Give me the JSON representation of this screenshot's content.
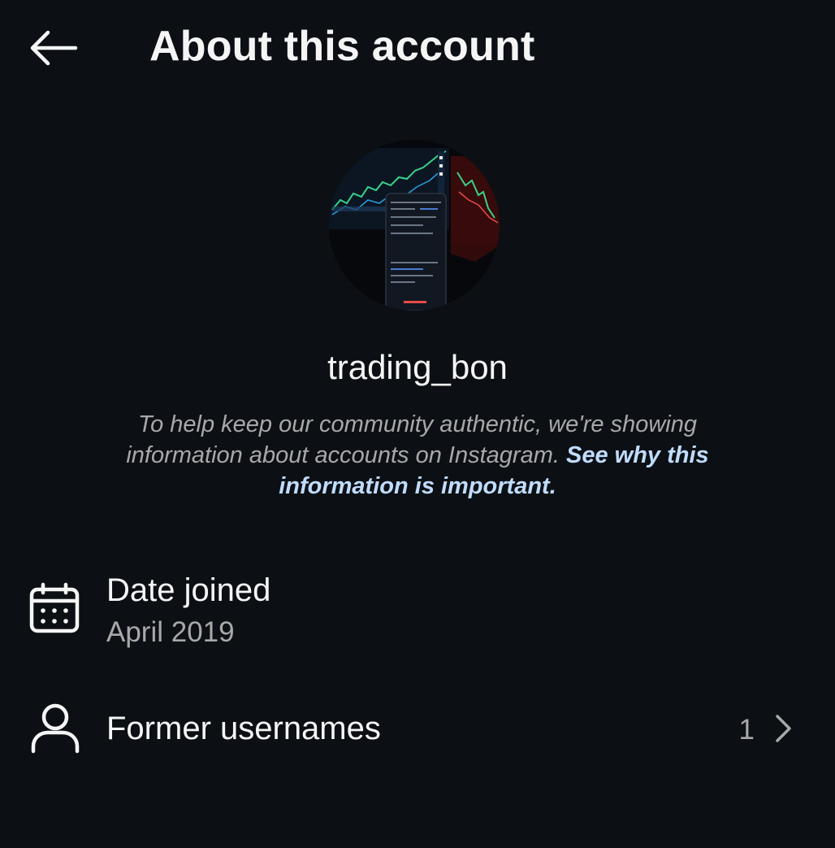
{
  "header": {
    "title": "About this account",
    "back_icon": "arrow-left-icon"
  },
  "profile": {
    "username": "trading_bon",
    "avatar": "trading-chart-photo"
  },
  "info": {
    "text": "To help keep our community authentic, we're showing information about accounts on Instagram. ",
    "link": "See why this information is important."
  },
  "rows": [
    {
      "icon": "calendar-icon",
      "title": "Date joined",
      "value": "April 2019"
    },
    {
      "icon": "person-icon",
      "title": "Former usernames",
      "count": "1",
      "chevron": "chevron-right-icon"
    }
  ],
  "colors": {
    "background": "#0c1014",
    "primary_text": "#f5f5f5",
    "secondary_text": "#a8a8a8",
    "link": "#c0dcff"
  }
}
